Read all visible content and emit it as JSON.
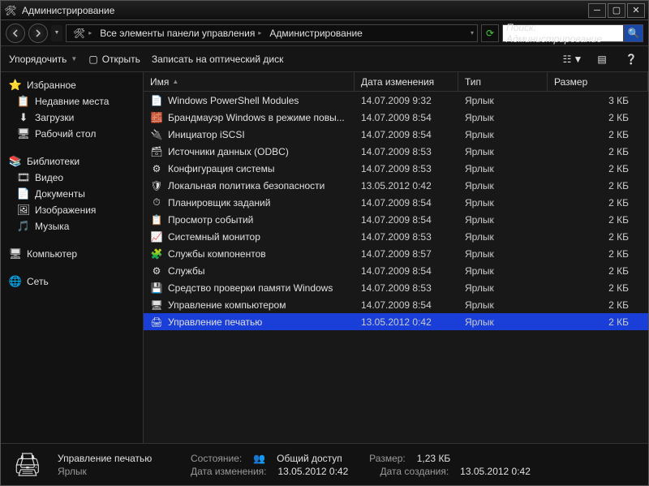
{
  "window": {
    "title": "Администрирование"
  },
  "breadcrumb": {
    "seg1": "Все элементы панели управления",
    "seg2": "Администрирование"
  },
  "search": {
    "placeholder": "Поиск: Администрирование"
  },
  "toolbar": {
    "organize": "Упорядочить",
    "open": "Открыть",
    "burn": "Записать на оптический диск"
  },
  "sidebar": {
    "fav_header": "Избранное",
    "fav": [
      "Недавние места",
      "Загрузки",
      "Рабочий стол"
    ],
    "lib_header": "Библиотеки",
    "lib": [
      "Видео",
      "Документы",
      "Изображения",
      "Музыка"
    ],
    "computer": "Компьютер",
    "network": "Сеть"
  },
  "columns": {
    "name": "Имя",
    "date": "Дата изменения",
    "type": "Тип",
    "size": "Размер"
  },
  "files": [
    {
      "name": "Windows PowerShell Modules",
      "date": "14.07.2009 9:32",
      "type": "Ярлык",
      "size": "3 КБ",
      "icon": "📄",
      "sel": false
    },
    {
      "name": "Брандмауэр Windows в режиме повы...",
      "date": "14.07.2009 8:54",
      "type": "Ярлык",
      "size": "2 КБ",
      "icon": "🧱",
      "sel": false
    },
    {
      "name": "Инициатор iSCSI",
      "date": "14.07.2009 8:54",
      "type": "Ярлык",
      "size": "2 КБ",
      "icon": "🔌",
      "sel": false
    },
    {
      "name": "Источники данных (ODBC)",
      "date": "14.07.2009 8:53",
      "type": "Ярлык",
      "size": "2 КБ",
      "icon": "🗃",
      "sel": false
    },
    {
      "name": "Конфигурация системы",
      "date": "14.07.2009 8:53",
      "type": "Ярлык",
      "size": "2 КБ",
      "icon": "⚙",
      "sel": false
    },
    {
      "name": "Локальная политика безопасности",
      "date": "13.05.2012 0:42",
      "type": "Ярлык",
      "size": "2 КБ",
      "icon": "🛡",
      "sel": false
    },
    {
      "name": "Планировщик заданий",
      "date": "14.07.2009 8:54",
      "type": "Ярлык",
      "size": "2 КБ",
      "icon": "⏱",
      "sel": false
    },
    {
      "name": "Просмотр событий",
      "date": "14.07.2009 8:54",
      "type": "Ярлык",
      "size": "2 КБ",
      "icon": "📋",
      "sel": false
    },
    {
      "name": "Системный монитор",
      "date": "14.07.2009 8:53",
      "type": "Ярлык",
      "size": "2 КБ",
      "icon": "📈",
      "sel": false
    },
    {
      "name": "Службы компонентов",
      "date": "14.07.2009 8:57",
      "type": "Ярлык",
      "size": "2 КБ",
      "icon": "🧩",
      "sel": false
    },
    {
      "name": "Службы",
      "date": "14.07.2009 8:54",
      "type": "Ярлык",
      "size": "2 КБ",
      "icon": "⚙",
      "sel": false
    },
    {
      "name": "Средство проверки памяти Windows",
      "date": "14.07.2009 8:53",
      "type": "Ярлык",
      "size": "2 КБ",
      "icon": "💾",
      "sel": false
    },
    {
      "name": "Управление компьютером",
      "date": "14.07.2009 8:54",
      "type": "Ярлык",
      "size": "2 КБ",
      "icon": "🖥",
      "sel": false
    },
    {
      "name": "Управление печатью",
      "date": "13.05.2012 0:42",
      "type": "Ярлык",
      "size": "2 КБ",
      "icon": "🖨",
      "sel": true
    }
  ],
  "status": {
    "name": "Управление печатью",
    "type": "Ярлык",
    "state_label": "Состояние:",
    "state": "Общий доступ",
    "date_label": "Дата изменения:",
    "date": "13.05.2012 0:42",
    "size_label": "Размер:",
    "size": "1,23 КБ",
    "created_label": "Дата создания:",
    "created": "13.05.2012 0:42"
  }
}
